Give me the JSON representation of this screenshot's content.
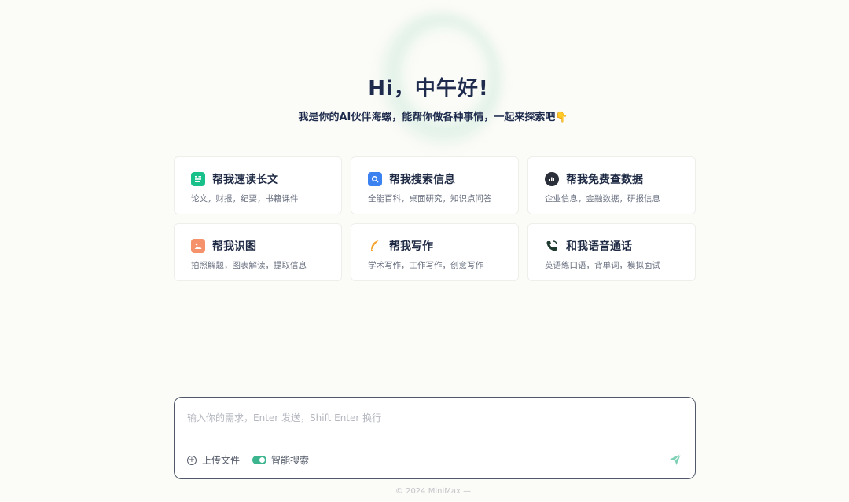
{
  "greeting": "Hi，中午好!",
  "subtitle": "我是你的AI伙伴海螺，能帮你做各种事情，一起来探索吧👇",
  "cards": [
    {
      "title": "帮我速读长文",
      "desc": "论文，财报，纪要，书籍课件",
      "icon": "document-lines-icon",
      "color": "#19c08a"
    },
    {
      "title": "帮我搜索信息",
      "desc": "全能百科，桌面研究，知识点问答",
      "icon": "search-doc-icon",
      "color": "#3b82f0"
    },
    {
      "title": "帮我免费查数据",
      "desc": "企业信息，金融数据，研报信息",
      "icon": "data-search-icon",
      "color": "#2b2f3a"
    },
    {
      "title": "帮我识图",
      "desc": "拍照解题，图表解读，提取信息",
      "icon": "image-icon",
      "color": "#f5926b"
    },
    {
      "title": "帮我写作",
      "desc": "学术写作，工作写作，创意写作",
      "icon": "feather-pen-icon",
      "color": "#f4a229"
    },
    {
      "title": "和我语音通话",
      "desc": "英语练口语，背单词，模拟面试",
      "icon": "phone-icon",
      "color": "#1f3a2e"
    }
  ],
  "input": {
    "placeholder": "输入你的需求，Enter 发送，Shift Enter 换行",
    "upload_label": "上传文件",
    "smart_search_label": "智能搜索"
  },
  "footer": "© 2024 MiniMax —"
}
